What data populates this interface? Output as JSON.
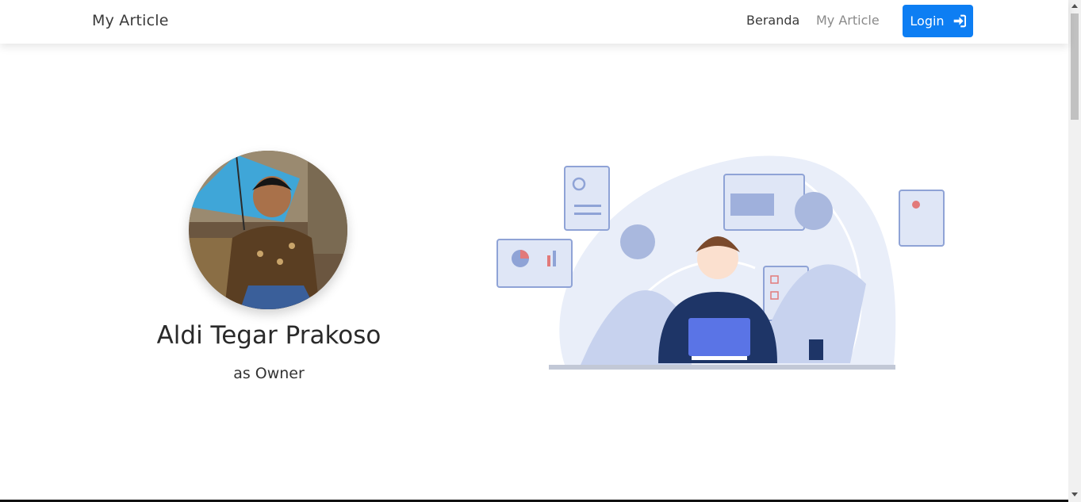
{
  "navbar": {
    "brand": "My Article",
    "links": [
      {
        "label": "Beranda"
      },
      {
        "label": "My Article"
      }
    ],
    "login_label": "Login"
  },
  "profile": {
    "name": "Aldi Tegar Prakoso",
    "role": "as Owner"
  },
  "colors": {
    "accent": "#0d7ef3",
    "illustration_blue": "#8fa3d6",
    "illustration_light": "#e6ecf8"
  },
  "icons": {
    "login": "sign-in-icon",
    "cursor": "hand-pointer-icon"
  }
}
